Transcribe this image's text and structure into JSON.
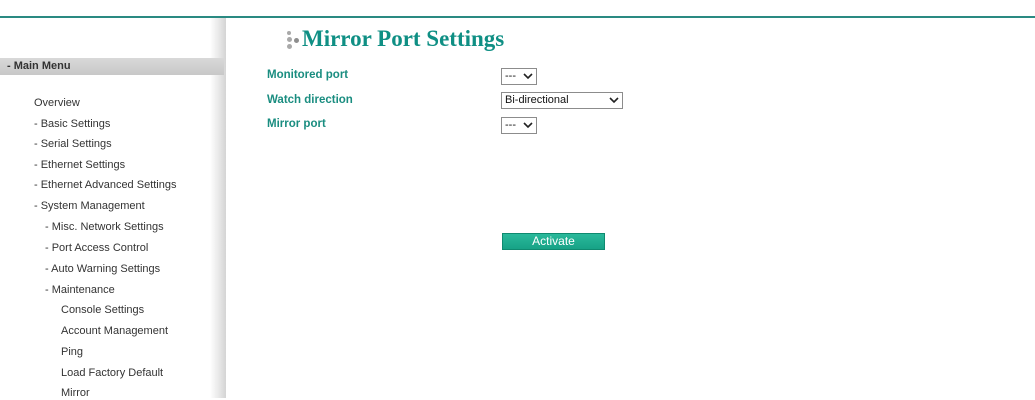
{
  "page": {
    "title": "Mirror Port Settings"
  },
  "sidebar": {
    "header": "- Main Menu",
    "items": [
      {
        "label": "Overview"
      },
      {
        "label": "- Basic Settings"
      },
      {
        "label": "- Serial Settings"
      },
      {
        "label": "- Ethernet Settings"
      },
      {
        "label": "- Ethernet Advanced Settings"
      },
      {
        "label": "- System Management"
      },
      {
        "label": "- Misc. Network Settings"
      },
      {
        "label": "- Port Access Control"
      },
      {
        "label": "- Auto Warning Settings"
      },
      {
        "label": "- Maintenance"
      },
      {
        "label": "Console Settings"
      },
      {
        "label": "Account Management"
      },
      {
        "label": "Ping"
      },
      {
        "label": "Load Factory Default"
      },
      {
        "label": "Mirror"
      }
    ]
  },
  "form": {
    "monitored_port": {
      "label": "Monitored port",
      "value": "---"
    },
    "watch_direction": {
      "label": "Watch direction",
      "value": "Bi-directional"
    },
    "mirror_port": {
      "label": "Mirror port",
      "value": "---"
    }
  },
  "actions": {
    "activate_label": "Activate"
  },
  "colors": {
    "accent": "#0f8f84",
    "label": "#1a8d80",
    "button": "#17a286",
    "menu_header_bg": "#d0d0d0"
  },
  "icons": {
    "title_bullet": "dots-icon",
    "select_arrow": "chevron-down-icon"
  }
}
